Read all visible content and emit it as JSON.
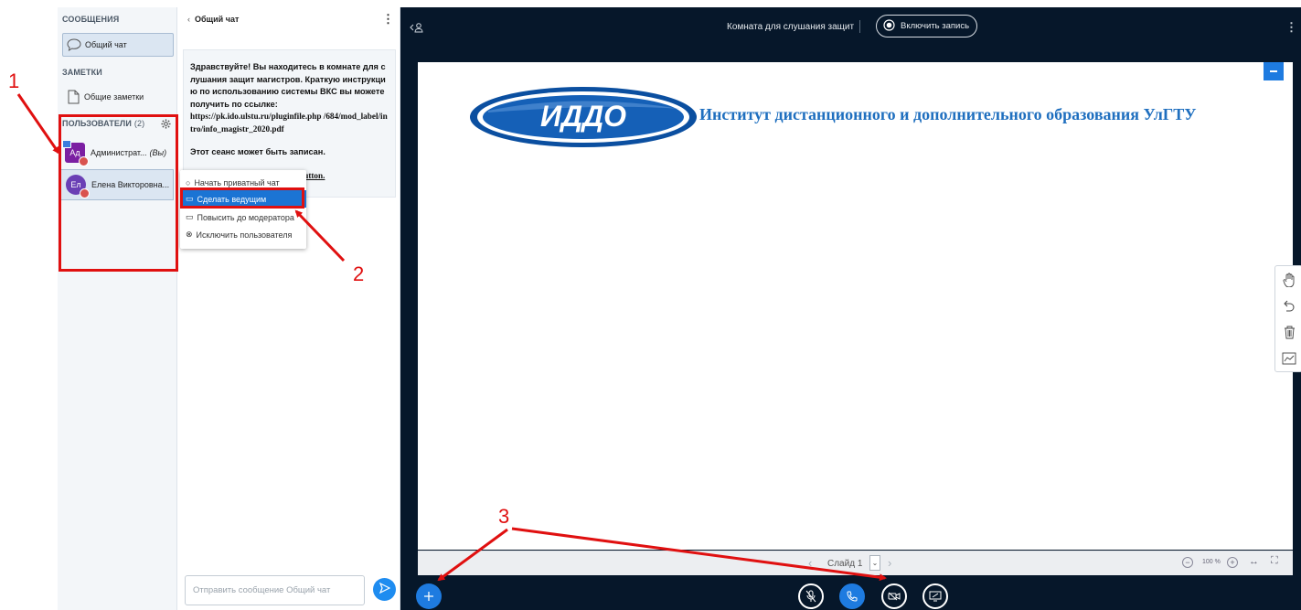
{
  "sidebar": {
    "messages_title": "СООБЩЕНИЯ",
    "public_chat_label": "Общий чат",
    "notes_title": "ЗАМЕТКИ",
    "shared_notes_label": "Общие заметки",
    "users_title": "ПОЛЬЗОВАТЕЛИ",
    "users_count": "(2)",
    "users": [
      {
        "initials": "Ад",
        "name": "Администрат...",
        "suffix": "(Вы)",
        "color": "#7b1fa2"
      },
      {
        "initials": "Ел",
        "name": "Елена Викторовна...",
        "suffix": "",
        "color": "#6a3fb5"
      }
    ]
  },
  "chat": {
    "title": "Общий чат",
    "welcome_p1": "Здравствуйте! Вы находитесь в комнате для слушания защит магистров. Краткую инструкцию по использованию системы ВКС вы можете получить по ссылке:",
    "welcome_link": "https://pk.ido.ulstu.ru/pluginfile.php /684/mod_label/intro/info_magistr_2020.pdf",
    "welcome_p2": "Этот сеанс может быть записан.",
    "welcome_p3_tail": "eButton.",
    "input_placeholder": "Отправить сообщение Общий чат"
  },
  "context_menu": {
    "items": [
      "Начать приватный чат",
      "Сделать ведущим",
      "Повысить до модератора",
      "Исключить пользователя"
    ]
  },
  "header": {
    "room_title": "Комната для слушания защит",
    "record_label": "Включить запись"
  },
  "slide": {
    "logo_text": "ИДДО",
    "heading": "Институт дистанционного и дополнительного образования УлГТУ",
    "nav_label": "Слайд 1",
    "zoom": "100 %"
  },
  "annotations": {
    "n1": "1",
    "n2": "2",
    "n3": "3"
  },
  "colors": {
    "accent": "#1e7be0",
    "annotation": "#e01010",
    "background": "#06172a"
  }
}
